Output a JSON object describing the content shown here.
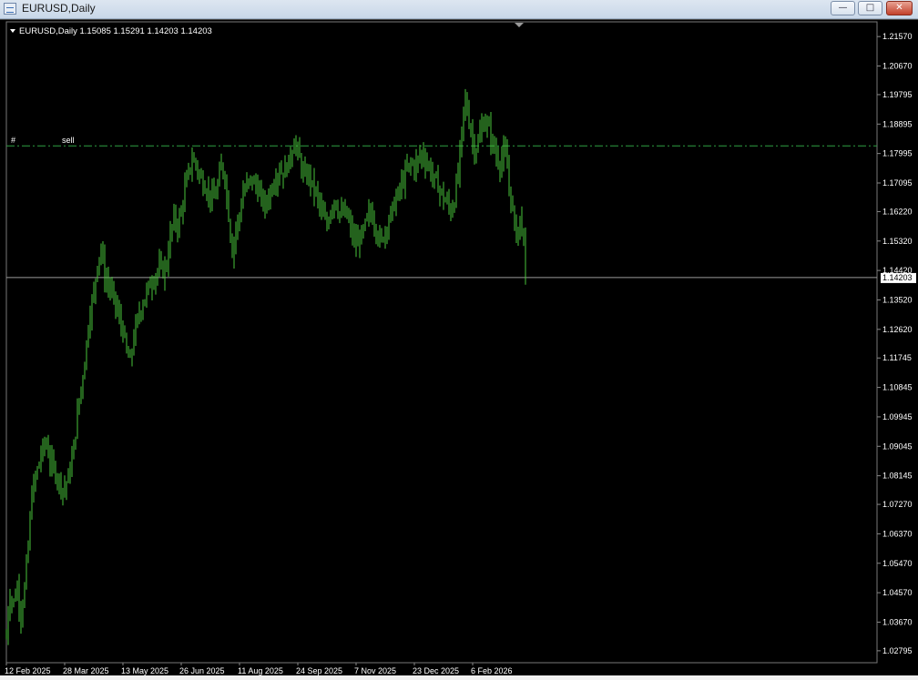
{
  "window": {
    "title": "EURUSD,Daily",
    "buttons": [
      "minimize",
      "maximize",
      "close"
    ]
  },
  "chart_header": {
    "text": "EURUSD,Daily  1.15085 1.15291 1.14203 1.14203"
  },
  "order_line": {
    "prefix": "#",
    "label": "sell",
    "price": 1.1823,
    "color": "#2ea043"
  },
  "current_price": {
    "label": "1.14203",
    "value": 1.14203
  },
  "colors": {
    "background": "#000000",
    "bars": "#49c43a",
    "axis_text": "#ffffff",
    "price_line": "#9a9a9a"
  },
  "chart_data": {
    "type": "ohlc",
    "symbol": "EURUSD",
    "timeframe": "Daily",
    "ylim": [
      1.0243,
      1.2202
    ],
    "y_ticks": [
      "1.21570",
      "1.20670",
      "1.19795",
      "1.18895",
      "1.17995",
      "1.17095",
      "1.16220",
      "1.15320",
      "1.14420",
      "1.13520",
      "1.12620",
      "1.11745",
      "1.10845",
      "1.09945",
      "1.09045",
      "1.08145",
      "1.07270",
      "1.06370",
      "1.05470",
      "1.04570",
      "1.03670",
      "1.02795"
    ],
    "x_ticks": [
      "12 Feb 2025",
      "28 Mar 2025",
      "13 May 2025",
      "26 Jun 2025",
      "11 Aug 2025",
      "24 Sep 2025",
      "7 Nov 2025",
      "23 Dec 2025",
      "6 Feb 2026"
    ],
    "series_path": [
      [
        0,
        1.032
      ],
      [
        3,
        1.045
      ],
      [
        8,
        1.043
      ],
      [
        12,
        1.047
      ],
      [
        16,
        1.039
      ],
      [
        20,
        1.047
      ],
      [
        24,
        1.06
      ],
      [
        28,
        1.076
      ],
      [
        33,
        1.082
      ],
      [
        38,
        1.088
      ],
      [
        43,
        1.092
      ],
      [
        48,
        1.086
      ],
      [
        53,
        1.083
      ],
      [
        58,
        1.08
      ],
      [
        63,
        1.077
      ],
      [
        68,
        1.081
      ],
      [
        72,
        1.086
      ],
      [
        76,
        1.095
      ],
      [
        80,
        1.105
      ],
      [
        84,
        1.112
      ],
      [
        88,
        1.122
      ],
      [
        92,
        1.132
      ],
      [
        96,
        1.137
      ],
      [
        100,
        1.147
      ],
      [
        104,
        1.151
      ],
      [
        108,
        1.142
      ],
      [
        112,
        1.14
      ],
      [
        116,
        1.137
      ],
      [
        120,
        1.134
      ],
      [
        124,
        1.129
      ],
      [
        128,
        1.126
      ],
      [
        132,
        1.119
      ],
      [
        136,
        1.116
      ],
      [
        140,
        1.124
      ],
      [
        144,
        1.129
      ],
      [
        148,
        1.133
      ],
      [
        152,
        1.136
      ],
      [
        156,
        1.139
      ],
      [
        160,
        1.141
      ],
      [
        164,
        1.143
      ],
      [
        168,
        1.145
      ],
      [
        172,
        1.144
      ],
      [
        176,
        1.146
      ],
      [
        180,
        1.155
      ],
      [
        184,
        1.16
      ],
      [
        188,
        1.158
      ],
      [
        192,
        1.162
      ],
      [
        196,
        1.169
      ],
      [
        200,
        1.174
      ],
      [
        204,
        1.178
      ],
      [
        208,
        1.177
      ],
      [
        212,
        1.173
      ],
      [
        216,
        1.171
      ],
      [
        220,
        1.169
      ],
      [
        224,
        1.167
      ],
      [
        228,
        1.166
      ],
      [
        232,
        1.17
      ],
      [
        236,
        1.176
      ],
      [
        240,
        1.173
      ],
      [
        244,
        1.161
      ],
      [
        248,
        1.15
      ],
      [
        252,
        1.157
      ],
      [
        256,
        1.161
      ],
      [
        260,
        1.168
      ],
      [
        264,
        1.17
      ],
      [
        268,
        1.172
      ],
      [
        272,
        1.171
      ],
      [
        276,
        1.169
      ],
      [
        280,
        1.166
      ],
      [
        284,
        1.164
      ],
      [
        288,
        1.167
      ],
      [
        292,
        1.17
      ],
      [
        296,
        1.173
      ],
      [
        300,
        1.175
      ],
      [
        304,
        1.174
      ],
      [
        308,
        1.176
      ],
      [
        312,
        1.179
      ],
      [
        316,
        1.184
      ],
      [
        320,
        1.18
      ],
      [
        324,
        1.176
      ],
      [
        328,
        1.172
      ],
      [
        332,
        1.174
      ],
      [
        336,
        1.17
      ],
      [
        340,
        1.168
      ],
      [
        344,
        1.164
      ],
      [
        348,
        1.16
      ],
      [
        352,
        1.158
      ],
      [
        356,
        1.163
      ],
      [
        360,
        1.166
      ],
      [
        364,
        1.163
      ],
      [
        368,
        1.161
      ],
      [
        372,
        1.162
      ],
      [
        376,
        1.159
      ],
      [
        380,
        1.155
      ],
      [
        384,
        1.152
      ],
      [
        388,
        1.154
      ],
      [
        392,
        1.156
      ],
      [
        396,
        1.16
      ],
      [
        400,
        1.162
      ],
      [
        404,
        1.159
      ],
      [
        408,
        1.155
      ],
      [
        412,
        1.153
      ],
      [
        416,
        1.157
      ],
      [
        420,
        1.16
      ],
      [
        424,
        1.163
      ],
      [
        428,
        1.166
      ],
      [
        432,
        1.169
      ],
      [
        436,
        1.172
      ],
      [
        440,
        1.175
      ],
      [
        444,
        1.177
      ],
      [
        448,
        1.176
      ],
      [
        452,
        1.178
      ],
      [
        456,
        1.18
      ],
      [
        460,
        1.178
      ],
      [
        464,
        1.176
      ],
      [
        468,
        1.173
      ],
      [
        472,
        1.171
      ],
      [
        476,
        1.169
      ],
      [
        480,
        1.166
      ],
      [
        484,
        1.165
      ],
      [
        488,
        1.162
      ],
      [
        492,
        1.166
      ],
      [
        496,
        1.174
      ],
      [
        500,
        1.186
      ],
      [
        503,
        1.197
      ],
      [
        506,
        1.193
      ],
      [
        510,
        1.187
      ],
      [
        514,
        1.181
      ],
      [
        518,
        1.183
      ],
      [
        522,
        1.188
      ],
      [
        526,
        1.19
      ],
      [
        530,
        1.187
      ],
      [
        534,
        1.183
      ],
      [
        538,
        1.179
      ],
      [
        542,
        1.177
      ],
      [
        546,
        1.18
      ],
      [
        549,
        1.178
      ],
      [
        552,
        1.17
      ],
      [
        556,
        1.162
      ],
      [
        560,
        1.155
      ],
      [
        564,
        1.16
      ],
      [
        567,
        1.156
      ],
      [
        569,
        1.15
      ],
      [
        570,
        1.14203
      ]
    ]
  }
}
